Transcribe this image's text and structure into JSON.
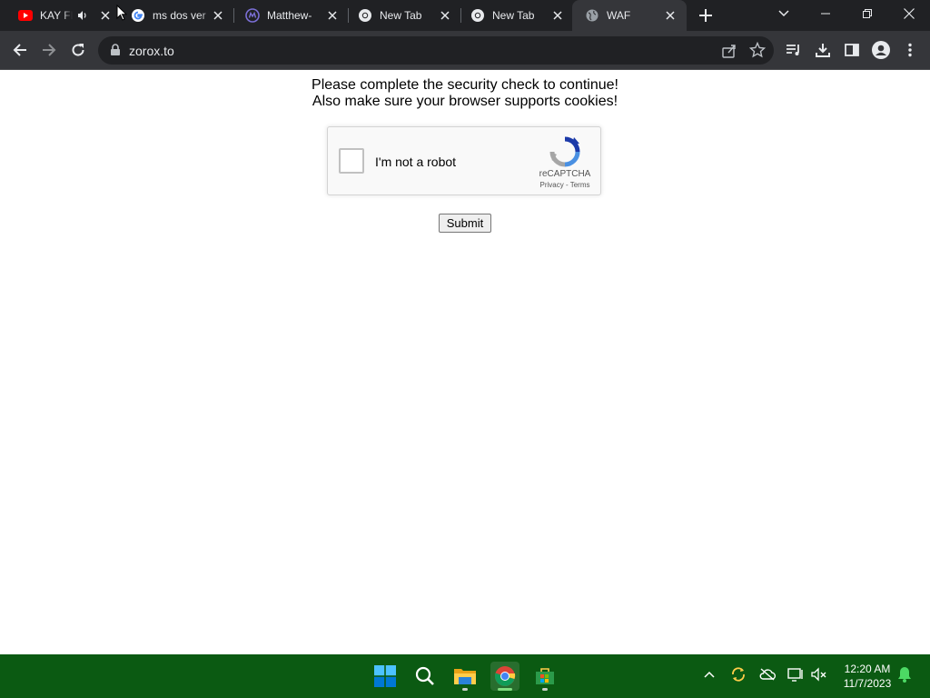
{
  "tabs": [
    {
      "title": "KAY FL",
      "icon": "youtube-icon"
    },
    {
      "title": "ms dos ver",
      "icon": "google-icon"
    },
    {
      "title": "Matthew-",
      "icon": "matthew-app-icon"
    },
    {
      "title": "New Tab",
      "icon": "chrome-icon"
    },
    {
      "title": "New Tab",
      "icon": "chrome-icon"
    },
    {
      "title": "WAF",
      "icon": "globe-icon",
      "active": true
    }
  ],
  "address_bar": {
    "url": "zorox.to"
  },
  "page": {
    "message_line1": "Please complete the security check to continue!",
    "message_line2": "Also make sure your browser supports cookies!",
    "captcha": {
      "label": "I'm not a robot",
      "brand": "reCAPTCHA",
      "privacy": "Privacy",
      "separator": " - ",
      "terms": "Terms"
    },
    "submit_label": "Submit"
  },
  "taskbar": {
    "time": "12:20 AM",
    "date": "11/7/2023"
  },
  "colors": {
    "tabstrip": "#202124",
    "toolbar": "#35363a",
    "taskbar": "#0b5a12",
    "recaptcha_blue": "#1c3aa9",
    "recaptcha_grey": "#a6a6a6"
  }
}
